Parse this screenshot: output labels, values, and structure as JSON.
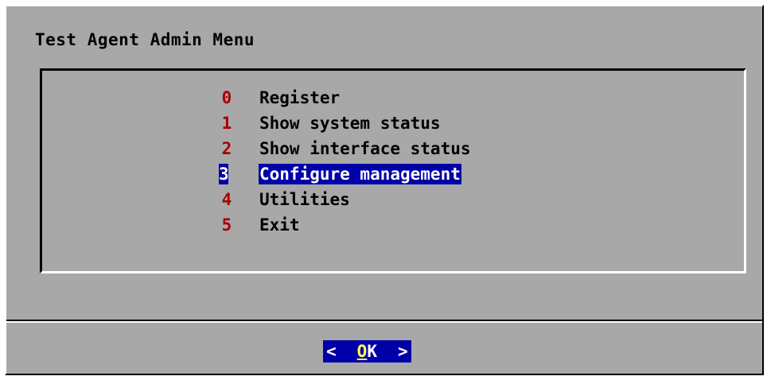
{
  "dialog": {
    "title": "Test Agent Admin Menu"
  },
  "menu": {
    "items": [
      {
        "key": "0",
        "label": "Register",
        "selected": false
      },
      {
        "key": "1",
        "label": "Show system status",
        "selected": false
      },
      {
        "key": "2",
        "label": "Show interface status",
        "selected": false
      },
      {
        "key": "3",
        "label": "Configure management",
        "selected": true
      },
      {
        "key": "4",
        "label": "Utilities",
        "selected": false
      },
      {
        "key": "5",
        "label": "Exit",
        "selected": false
      }
    ]
  },
  "buttons": {
    "ok": {
      "left_bracket": "<",
      "hotkey": "O",
      "rest": "K",
      "right_bracket": ">"
    }
  },
  "colors": {
    "dialog_background": "#a8a8a8",
    "menu_key": "#a80000",
    "selection_background": "#0000a8",
    "selection_text": "#ffffff",
    "hotkey": "#ffff55"
  }
}
